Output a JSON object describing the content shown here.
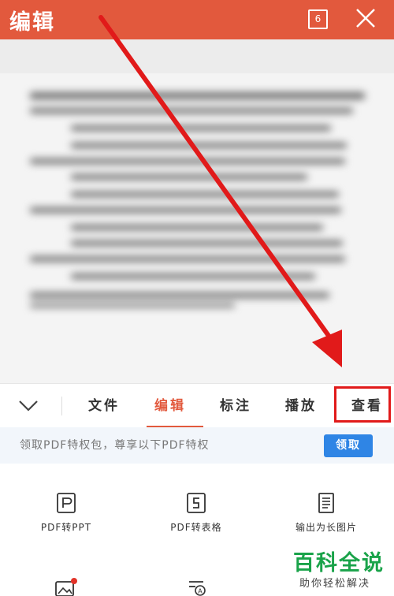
{
  "header": {
    "title": "编辑",
    "page_count": "6",
    "close_icon": "close-icon",
    "background": "#e2593d"
  },
  "tabs": [
    {
      "label": "文件",
      "active": false
    },
    {
      "label": "编辑",
      "active": true
    },
    {
      "label": "标注",
      "active": false
    },
    {
      "label": "播放",
      "active": false
    },
    {
      "label": "查看",
      "active": false
    }
  ],
  "promo": {
    "text": "领取PDF特权包，尊享以下PDF特权",
    "button": "领取"
  },
  "tools": [
    {
      "label": "PDF转PPT",
      "icon": "pdf-to-ppt-icon"
    },
    {
      "label": "PDF转表格",
      "icon": "pdf-to-excel-icon"
    },
    {
      "label": "输出为长图片",
      "icon": "export-long-image-icon"
    },
    {
      "label": "",
      "icon": "image-icon"
    },
    {
      "label": "",
      "icon": "text-recognition-icon"
    }
  ],
  "watermark": {
    "main": "百科全说",
    "sub": "助你轻松解决"
  },
  "colors": {
    "accent": "#e2593d",
    "button": "#2f85e5",
    "highlight": "#e11a1a"
  }
}
